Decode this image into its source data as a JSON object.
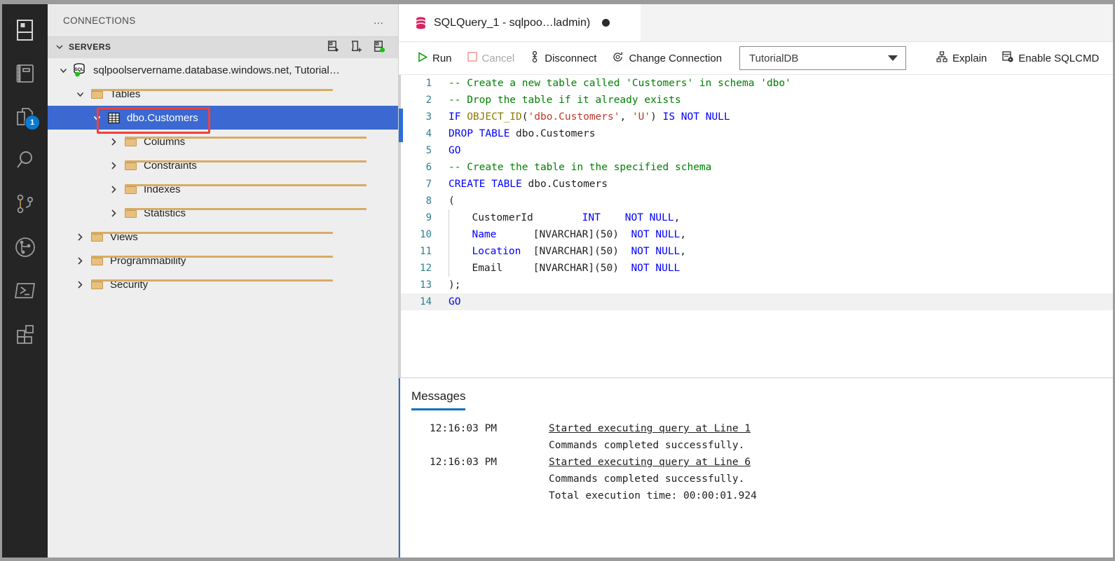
{
  "activity_bar": {
    "items": [
      {
        "name": "connections-icon",
        "label": "Connections"
      },
      {
        "name": "notebooks-icon",
        "label": "Notebooks"
      },
      {
        "name": "explorer-icon",
        "label": "Explorer",
        "badge": "1"
      },
      {
        "name": "search-icon",
        "label": "Search"
      },
      {
        "name": "source-control-icon",
        "label": "Source Control"
      },
      {
        "name": "git-graph-icon",
        "label": "Git Graph"
      },
      {
        "name": "terminal-icon",
        "label": "Terminal"
      },
      {
        "name": "extensions-icon",
        "label": "Extensions"
      }
    ]
  },
  "sidebar": {
    "title": "CONNECTIONS",
    "more_actions": "…",
    "section": {
      "label": "SERVERS",
      "actions": [
        {
          "name": "new-connection-icon",
          "tooltip": "New Connection"
        },
        {
          "name": "new-server-group-icon",
          "tooltip": "New Server Group"
        },
        {
          "name": "active-connections-icon",
          "tooltip": "Show Active Connections"
        }
      ]
    },
    "tree": [
      {
        "label": "sqlpoolservername.database.windows.net, Tutorial…",
        "icon": "sql-server-icon",
        "indent": 0,
        "expanded": true,
        "selected": false,
        "status": "connected"
      },
      {
        "label": "Tables",
        "icon": "folder-icon",
        "indent": 1,
        "expanded": true,
        "selected": false
      },
      {
        "label": "dbo.Customers",
        "icon": "table-icon",
        "indent": 2,
        "expanded": true,
        "selected": true,
        "highlighted": true
      },
      {
        "label": "Columns",
        "icon": "folder-icon",
        "indent": 3,
        "expanded": false,
        "selected": false
      },
      {
        "label": "Constraints",
        "icon": "folder-icon",
        "indent": 3,
        "expanded": false,
        "selected": false
      },
      {
        "label": "Indexes",
        "icon": "folder-icon",
        "indent": 3,
        "expanded": false,
        "selected": false
      },
      {
        "label": "Statistics",
        "icon": "folder-icon",
        "indent": 3,
        "expanded": false,
        "selected": false
      },
      {
        "label": "Views",
        "icon": "folder-icon",
        "indent": 1,
        "expanded": false,
        "selected": false
      },
      {
        "label": "Programmability",
        "icon": "folder-icon",
        "indent": 1,
        "expanded": false,
        "selected": false
      },
      {
        "label": "Security",
        "icon": "folder-icon",
        "indent": 1,
        "expanded": false,
        "selected": false
      }
    ]
  },
  "editor_tab": {
    "icon": "query-file-icon",
    "title": "SQLQuery_1 - sqlpoo…ladmin)",
    "dirty": true
  },
  "toolbar": {
    "run_label": "Run",
    "cancel_label": "Cancel",
    "disconnect_label": "Disconnect",
    "change_connection_label": "Change Connection",
    "database_value": "TutorialDB",
    "explain_label": "Explain",
    "sqlcmd_label": "Enable SQLCMD"
  },
  "code": {
    "lines": [
      {
        "n": "1",
        "tokens": [
          {
            "t": "-- Create a new table called 'Customers' in schema 'dbo'",
            "c": "cm"
          }
        ]
      },
      {
        "n": "2",
        "tokens": [
          {
            "t": "-- Drop the table if it already exists",
            "c": "cm"
          }
        ]
      },
      {
        "n": "3",
        "tokens": [
          {
            "t": "IF ",
            "c": "kw"
          },
          {
            "t": "OBJECT_ID",
            "c": "fn"
          },
          {
            "t": "(",
            "c": "pl"
          },
          {
            "t": "'dbo.Customers'",
            "c": "str"
          },
          {
            "t": ", ",
            "c": "pl"
          },
          {
            "t": "'U'",
            "c": "str"
          },
          {
            "t": ") ",
            "c": "pl"
          },
          {
            "t": "IS NOT NULL",
            "c": "kw"
          }
        ]
      },
      {
        "n": "4",
        "tokens": [
          {
            "t": "DROP TABLE ",
            "c": "kw"
          },
          {
            "t": "dbo.Customers",
            "c": "pl"
          }
        ]
      },
      {
        "n": "5",
        "tokens": [
          {
            "t": "GO",
            "c": "kw"
          }
        ]
      },
      {
        "n": "6",
        "tokens": [
          {
            "t": "-- Create the table in the specified schema",
            "c": "cm"
          }
        ]
      },
      {
        "n": "7",
        "tokens": [
          {
            "t": "CREATE TABLE ",
            "c": "kw"
          },
          {
            "t": "dbo.Customers",
            "c": "pl"
          }
        ]
      },
      {
        "n": "8",
        "tokens": [
          {
            "t": "(",
            "c": "pl"
          }
        ]
      },
      {
        "n": "9",
        "tokens": [
          {
            "t": "  CustomerId        ",
            "c": "pl"
          },
          {
            "t": "INT",
            "c": "kw"
          },
          {
            "t": "    ",
            "c": "pl"
          },
          {
            "t": "NOT NULL",
            "c": "kw"
          },
          {
            "t": ",",
            "c": "pl"
          }
        ],
        "indent": true
      },
      {
        "n": "10",
        "tokens": [
          {
            "t": "  Name",
            "c": "kw"
          },
          {
            "t": "      [NVARCHAR](",
            "c": "pl"
          },
          {
            "t": "50",
            "c": "pl"
          },
          {
            "t": ")  ",
            "c": "pl"
          },
          {
            "t": "NOT NULL",
            "c": "kw"
          },
          {
            "t": ",",
            "c": "pl"
          }
        ],
        "indent": true
      },
      {
        "n": "11",
        "tokens": [
          {
            "t": "  Location",
            "c": "kw"
          },
          {
            "t": "  [NVARCHAR](50)  ",
            "c": "pl"
          },
          {
            "t": "NOT NULL",
            "c": "kw"
          },
          {
            "t": ",",
            "c": "pl"
          }
        ],
        "indent": true
      },
      {
        "n": "12",
        "tokens": [
          {
            "t": "  Email     [NVARCHAR](50)  ",
            "c": "pl"
          },
          {
            "t": "NOT NULL",
            "c": "kw"
          }
        ],
        "indent": true
      },
      {
        "n": "13",
        "tokens": [
          {
            "t": ");",
            "c": "pl"
          }
        ]
      },
      {
        "n": "14",
        "tokens": [
          {
            "t": "GO",
            "c": "kw"
          }
        ],
        "batch": true
      }
    ]
  },
  "messages": {
    "tab_label": "Messages",
    "rows": [
      {
        "time": "12:16:03 PM",
        "text": "Started executing query at Line 1",
        "link": true
      },
      {
        "time": "",
        "text": "Commands completed successfully.",
        "link": false
      },
      {
        "time": "12:16:03 PM",
        "text": "Started executing query at Line 6",
        "link": true
      },
      {
        "time": "",
        "text": "Commands completed successfully.",
        "link": false
      },
      {
        "time": "",
        "text": "Total execution time: 00:00:01.924",
        "link": false
      }
    ]
  },
  "colors": {
    "selection_blue": "#3b69d1",
    "annotation_red": "#f0413b",
    "accent_blue": "#0a6fc2",
    "connected_green": "#16c60c",
    "keyword_blue": "#0000ff",
    "comment_green": "#008000",
    "string_red": "#c0392b"
  }
}
